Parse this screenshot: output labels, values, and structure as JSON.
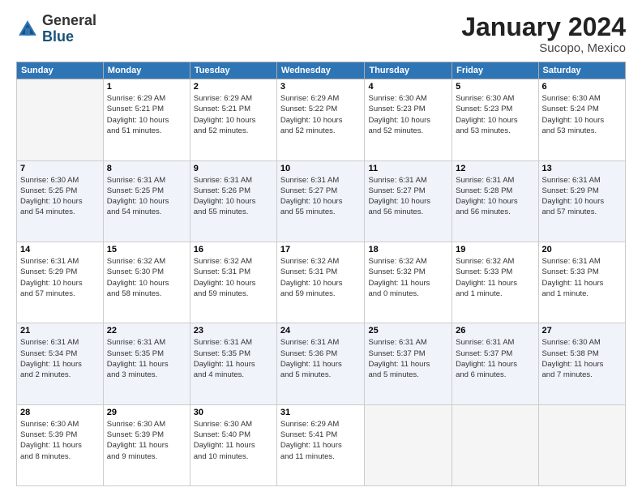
{
  "header": {
    "logo_line1": "General",
    "logo_line2": "Blue",
    "month": "January 2024",
    "location": "Sucopo, Mexico"
  },
  "days_of_week": [
    "Sunday",
    "Monday",
    "Tuesday",
    "Wednesday",
    "Thursday",
    "Friday",
    "Saturday"
  ],
  "weeks": [
    [
      {
        "day": "",
        "info": ""
      },
      {
        "day": "1",
        "info": "Sunrise: 6:29 AM\nSunset: 5:21 PM\nDaylight: 10 hours\nand 51 minutes."
      },
      {
        "day": "2",
        "info": "Sunrise: 6:29 AM\nSunset: 5:21 PM\nDaylight: 10 hours\nand 52 minutes."
      },
      {
        "day": "3",
        "info": "Sunrise: 6:29 AM\nSunset: 5:22 PM\nDaylight: 10 hours\nand 52 minutes."
      },
      {
        "day": "4",
        "info": "Sunrise: 6:30 AM\nSunset: 5:23 PM\nDaylight: 10 hours\nand 52 minutes."
      },
      {
        "day": "5",
        "info": "Sunrise: 6:30 AM\nSunset: 5:23 PM\nDaylight: 10 hours\nand 53 minutes."
      },
      {
        "day": "6",
        "info": "Sunrise: 6:30 AM\nSunset: 5:24 PM\nDaylight: 10 hours\nand 53 minutes."
      }
    ],
    [
      {
        "day": "7",
        "info": "Sunrise: 6:30 AM\nSunset: 5:25 PM\nDaylight: 10 hours\nand 54 minutes."
      },
      {
        "day": "8",
        "info": "Sunrise: 6:31 AM\nSunset: 5:25 PM\nDaylight: 10 hours\nand 54 minutes."
      },
      {
        "day": "9",
        "info": "Sunrise: 6:31 AM\nSunset: 5:26 PM\nDaylight: 10 hours\nand 55 minutes."
      },
      {
        "day": "10",
        "info": "Sunrise: 6:31 AM\nSunset: 5:27 PM\nDaylight: 10 hours\nand 55 minutes."
      },
      {
        "day": "11",
        "info": "Sunrise: 6:31 AM\nSunset: 5:27 PM\nDaylight: 10 hours\nand 56 minutes."
      },
      {
        "day": "12",
        "info": "Sunrise: 6:31 AM\nSunset: 5:28 PM\nDaylight: 10 hours\nand 56 minutes."
      },
      {
        "day": "13",
        "info": "Sunrise: 6:31 AM\nSunset: 5:29 PM\nDaylight: 10 hours\nand 57 minutes."
      }
    ],
    [
      {
        "day": "14",
        "info": "Sunrise: 6:31 AM\nSunset: 5:29 PM\nDaylight: 10 hours\nand 57 minutes."
      },
      {
        "day": "15",
        "info": "Sunrise: 6:32 AM\nSunset: 5:30 PM\nDaylight: 10 hours\nand 58 minutes."
      },
      {
        "day": "16",
        "info": "Sunrise: 6:32 AM\nSunset: 5:31 PM\nDaylight: 10 hours\nand 59 minutes."
      },
      {
        "day": "17",
        "info": "Sunrise: 6:32 AM\nSunset: 5:31 PM\nDaylight: 10 hours\nand 59 minutes."
      },
      {
        "day": "18",
        "info": "Sunrise: 6:32 AM\nSunset: 5:32 PM\nDaylight: 11 hours\nand 0 minutes."
      },
      {
        "day": "19",
        "info": "Sunrise: 6:32 AM\nSunset: 5:33 PM\nDaylight: 11 hours\nand 1 minute."
      },
      {
        "day": "20",
        "info": "Sunrise: 6:31 AM\nSunset: 5:33 PM\nDaylight: 11 hours\nand 1 minute."
      }
    ],
    [
      {
        "day": "21",
        "info": "Sunrise: 6:31 AM\nSunset: 5:34 PM\nDaylight: 11 hours\nand 2 minutes."
      },
      {
        "day": "22",
        "info": "Sunrise: 6:31 AM\nSunset: 5:35 PM\nDaylight: 11 hours\nand 3 minutes."
      },
      {
        "day": "23",
        "info": "Sunrise: 6:31 AM\nSunset: 5:35 PM\nDaylight: 11 hours\nand 4 minutes."
      },
      {
        "day": "24",
        "info": "Sunrise: 6:31 AM\nSunset: 5:36 PM\nDaylight: 11 hours\nand 5 minutes."
      },
      {
        "day": "25",
        "info": "Sunrise: 6:31 AM\nSunset: 5:37 PM\nDaylight: 11 hours\nand 5 minutes."
      },
      {
        "day": "26",
        "info": "Sunrise: 6:31 AM\nSunset: 5:37 PM\nDaylight: 11 hours\nand 6 minutes."
      },
      {
        "day": "27",
        "info": "Sunrise: 6:30 AM\nSunset: 5:38 PM\nDaylight: 11 hours\nand 7 minutes."
      }
    ],
    [
      {
        "day": "28",
        "info": "Sunrise: 6:30 AM\nSunset: 5:39 PM\nDaylight: 11 hours\nand 8 minutes."
      },
      {
        "day": "29",
        "info": "Sunrise: 6:30 AM\nSunset: 5:39 PM\nDaylight: 11 hours\nand 9 minutes."
      },
      {
        "day": "30",
        "info": "Sunrise: 6:30 AM\nSunset: 5:40 PM\nDaylight: 11 hours\nand 10 minutes."
      },
      {
        "day": "31",
        "info": "Sunrise: 6:29 AM\nSunset: 5:41 PM\nDaylight: 11 hours\nand 11 minutes."
      },
      {
        "day": "",
        "info": ""
      },
      {
        "day": "",
        "info": ""
      },
      {
        "day": "",
        "info": ""
      }
    ]
  ]
}
